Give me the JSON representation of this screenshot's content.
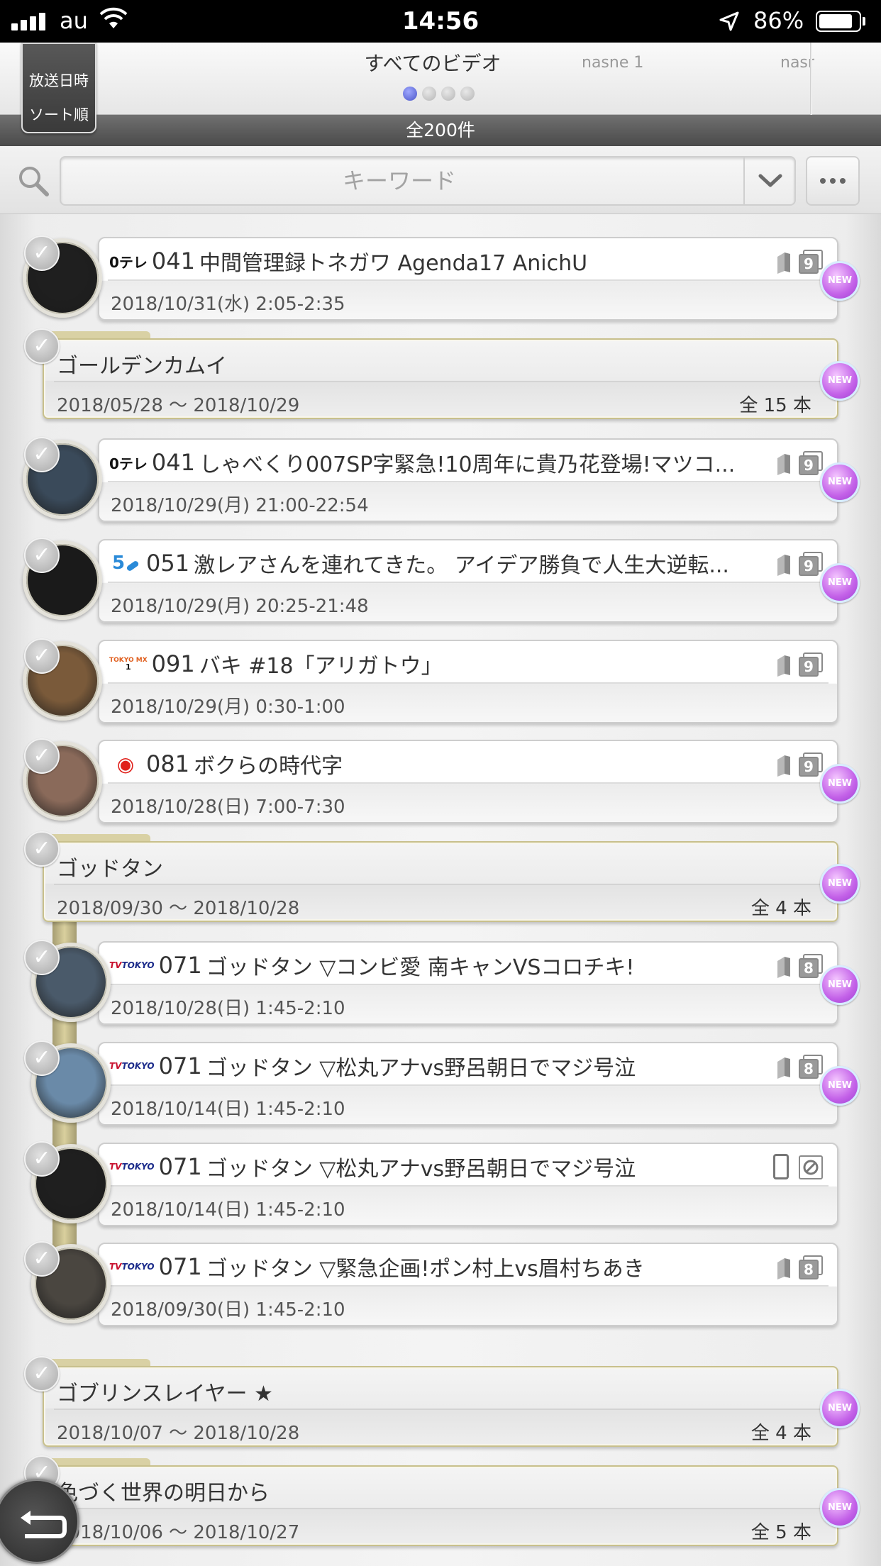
{
  "status_bar": {
    "carrier": "au",
    "time": "14:56",
    "battery": "86%"
  },
  "header": {
    "sort_line1": "放送日時",
    "sort_line2": "ソート順",
    "tab_title": "すべてのビデオ",
    "tab_next": "nasne 1",
    "tab_next2": "nasr",
    "count": "全200件"
  },
  "search": {
    "placeholder": "キーワード"
  },
  "items": [
    {
      "type": "video",
      "channel_logo": "0テレ",
      "channel": "041",
      "title": "中間管理録トネガワ Agenda17 AnichU",
      "datetime": "2018/10/31(水) 2:05-2:35",
      "new": "NEW",
      "copy_count": "9"
    },
    {
      "type": "series",
      "title": "ゴールデンカムイ",
      "range": "2018/05/28 〜 2018/10/29",
      "count": "全 15 本",
      "new": "NEW"
    },
    {
      "type": "video",
      "channel_logo": "0テレ",
      "channel": "041",
      "title": "しゃべくり007SP字緊急!10周年に貴乃花登場!マツコ...",
      "datetime": "2018/10/29(月) 21:00-22:54",
      "new": "NEW",
      "copy_count": "9"
    },
    {
      "type": "video",
      "channel_logo": "5",
      "channel": "051",
      "title": "激レアさんを連れてきた。 アイデア勝負で人生大逆転...",
      "datetime": "2018/10/29(月) 20:25-21:48",
      "new": "NEW",
      "copy_count": "9"
    },
    {
      "type": "video",
      "channel_logo": "TOKYO MX 1",
      "channel": "091",
      "title": "バキ #18「アリガトウ」",
      "datetime": "2018/10/29(月) 0:30-1:00",
      "new": "",
      "copy_count": "9"
    },
    {
      "type": "video",
      "channel_logo": "◉",
      "channel": "081",
      "title": "ボクらの時代字",
      "datetime": "2018/10/28(日) 7:00-7:30",
      "new": "NEW",
      "copy_count": "9"
    },
    {
      "type": "series",
      "title": "ゴッドタン",
      "range": "2018/09/30 〜 2018/10/28",
      "count": "全 4 本",
      "new": "NEW"
    },
    {
      "type": "video",
      "channel_logo": "TV TOKYO",
      "channel": "071",
      "title": "ゴッドタン ▽コンビ愛 南キャンVSコロチキ!",
      "datetime": "2018/10/28(日) 1:45-2:10",
      "new": "NEW",
      "copy_count": "8"
    },
    {
      "type": "video",
      "channel_logo": "TV TOKYO",
      "channel": "071",
      "title": "ゴッドタン ▽松丸アナvs野呂朝日でマジ号泣",
      "datetime": "2018/10/14(日) 1:45-2:10",
      "new": "NEW",
      "copy_count": "8"
    },
    {
      "type": "video",
      "channel_logo": "TV TOKYO",
      "channel": "071",
      "title": "ゴッドタン ▽松丸アナvs野呂朝日でマジ号泣",
      "datetime": "2018/10/14(日) 1:45-2:10",
      "new": "",
      "copy_count": ""
    },
    {
      "type": "video",
      "channel_logo": "TV TOKYO",
      "channel": "071",
      "title": "ゴッドタン ▽緊急企画!ポン村上vs眉村ちあき",
      "datetime": "2018/09/30(日) 1:45-2:10",
      "new": "",
      "copy_count": "8"
    },
    {
      "type": "series",
      "title": "ゴブリンスレイヤー ★",
      "range": "2018/10/07 〜 2018/10/28",
      "count": "全 4 本",
      "new": "NEW"
    },
    {
      "type": "series",
      "title": "色づく世界の明日から",
      "range": "2018/10/06 〜 2018/10/27",
      "count": "全 5 本",
      "new": "NEW"
    }
  ]
}
